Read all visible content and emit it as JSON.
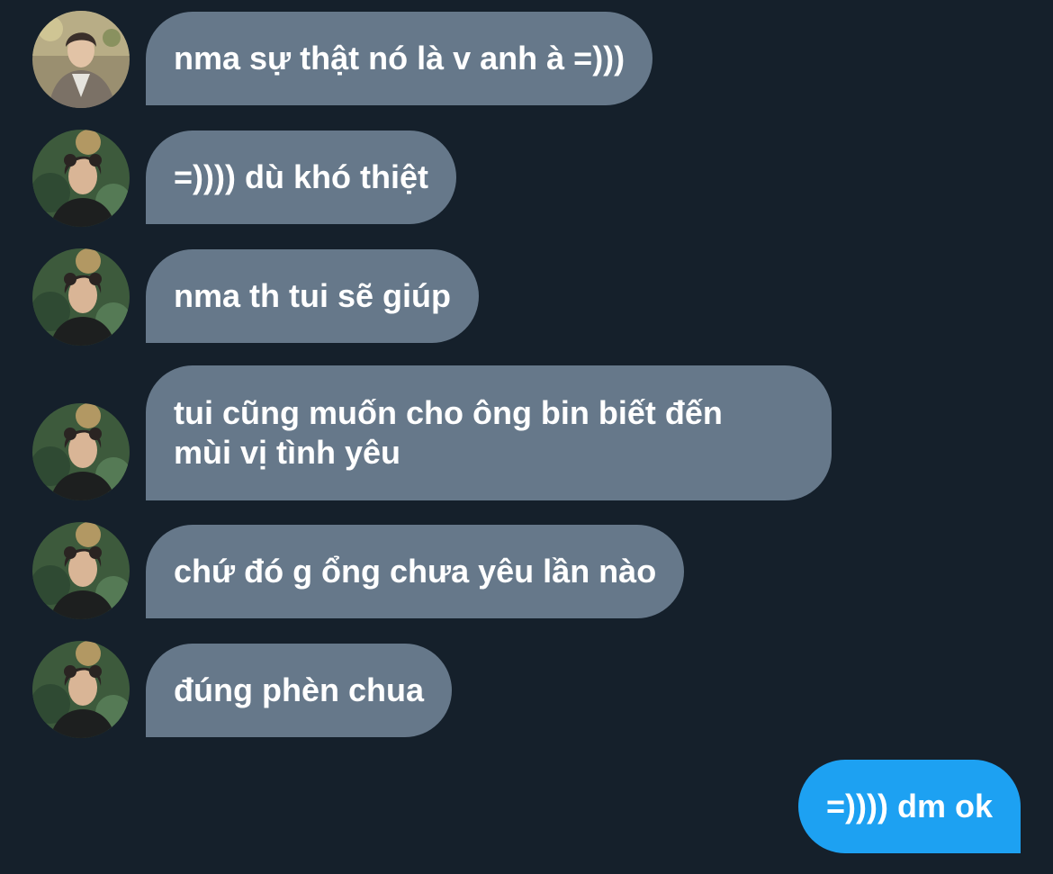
{
  "conversation": {
    "messages": [
      {
        "direction": "incoming",
        "sender_avatar": "avatar-person-jacket",
        "text": "nma sự thật nó là v anh à =)))"
      },
      {
        "direction": "incoming",
        "sender_avatar": "avatar-person-curly",
        "text": "=)))) dù khó thiệt"
      },
      {
        "direction": "incoming",
        "sender_avatar": "avatar-person-curly",
        "text": "nma th tui sẽ giúp"
      },
      {
        "direction": "incoming",
        "sender_avatar": "avatar-person-curly",
        "text": "tui cũng muốn cho ông bin biết đến\nmùi vị tình yêu"
      },
      {
        "direction": "incoming",
        "sender_avatar": "avatar-person-curly",
        "text": "chứ đó g ổng chưa yêu lần nào"
      },
      {
        "direction": "incoming",
        "sender_avatar": "avatar-person-curly",
        "text": "đúng phèn chua"
      },
      {
        "direction": "outgoing",
        "text": "=)))) dm ok"
      }
    ]
  },
  "colors": {
    "background": "#15202b",
    "incoming_bubble": "#66788a",
    "outgoing_bubble": "#1da1f2",
    "text": "#ffffff"
  }
}
